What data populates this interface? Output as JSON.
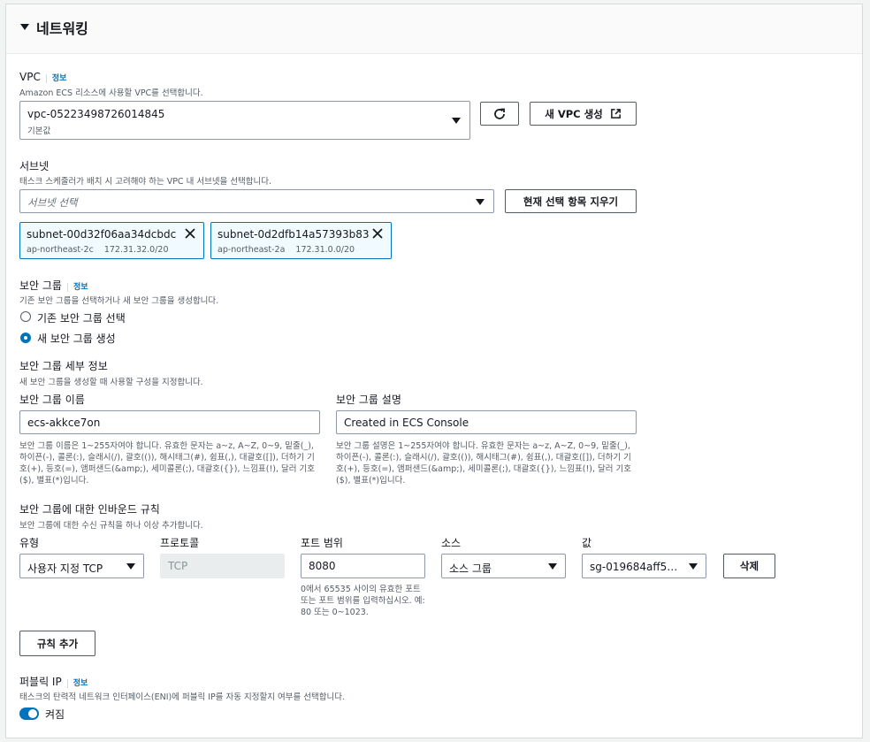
{
  "section": {
    "title": "네트워킹"
  },
  "vpc": {
    "label": "VPC",
    "info": "정보",
    "description": "Amazon ECS 리소스에 사용할 VPC를 선택합니다.",
    "selected": "vpc-05223498726014845",
    "selected_sub": "기본값",
    "create_button": "새 VPC 생성"
  },
  "subnet": {
    "label": "서브넷",
    "description": "태스크 스케줄러가 배치 시 고려해야 하는 VPC 내 서브넷을 선택합니다.",
    "placeholder": "서브넷 선택",
    "clear_button": "현재 선택 항목 지우기",
    "tokens": [
      {
        "id": "subnet-00d32f06aa34dcbdc",
        "az": "ap-northeast-2c",
        "cidr": "172.31.32.0/20"
      },
      {
        "id": "subnet-0d2dfb14a57393b83",
        "az": "ap-northeast-2a",
        "cidr": "172.31.0.0/20"
      }
    ]
  },
  "security_group": {
    "label": "보안 그룹",
    "info": "정보",
    "description": "기존 보안 그룹을 선택하거나 새 보안 그룹을 생성합니다.",
    "option_existing": "기존 보안 그룹 선택",
    "option_new": "새 보안 그룹 생성"
  },
  "sg_details": {
    "label": "보안 그룹 세부 정보",
    "description": "새 보안 그룹을 생성할 때 사용할 구성을 지정합니다.",
    "name_label": "보안 그룹 이름",
    "name_value": "ecs-akkce7on",
    "name_help": "보안 그룹 이름은 1~255자여야 합니다. 유효한 문자는 a~z, A~Z, 0~9, 밑줄(_), 하이픈(-), 콜론(:), 슬래시(/), 괄호(()), 해시태그(#), 쉼표(,), 대괄호([]), 더하기 기호(+), 등호(=), 앰퍼샌드(&amp;), 세미콜론(;), 대괄호({}), 느낌표(!), 달러 기호($), 별표(*)입니다.",
    "desc_label": "보안 그룹 설명",
    "desc_value": "Created in ECS Console",
    "desc_help": "보안 그룹 설명은 1~255자여야 합니다. 유효한 문자는 a~z, A~Z, 0~9, 밑줄(_), 하이픈(-), 콜론(:), 슬래시(/), 괄호(()), 해시태그(#), 쉼표(,), 대괄호([]), 더하기 기호(+), 등호(=), 앰퍼샌드(&amp;), 세미콜론(;), 대괄호({}), 느낌표(!), 달러 기호($), 별표(*)입니다."
  },
  "inbound": {
    "label": "보안 그룹에 대한 인바운드 규칙",
    "description": "보안 그룹에 대한 수신 규칙을 하나 이상 추가합니다.",
    "columns": {
      "type": "유형",
      "protocol": "프로토콜",
      "port": "포트 범위",
      "source": "소스",
      "value": "값"
    },
    "rule": {
      "type": "사용자 지정 TCP",
      "protocol": "TCP",
      "port": "8080",
      "source": "소스 그룹",
      "value": "sg-019684aff5…"
    },
    "port_help": "0에서 65535 사이의 유효한 포트 또는 포트 범위를 입력하십시오. 예: 80 또는 0~1023.",
    "delete_button": "삭제",
    "add_rule_button": "규칙 추가"
  },
  "public_ip": {
    "label": "퍼블릭 IP",
    "info": "정보",
    "description": "태스크의 탄력적 네트워크 인터페이스(ENI)에 퍼블릭 IP를 자동 지정할지 여부를 선택합니다.",
    "toggle_label": "켜짐",
    "enabled": true
  }
}
